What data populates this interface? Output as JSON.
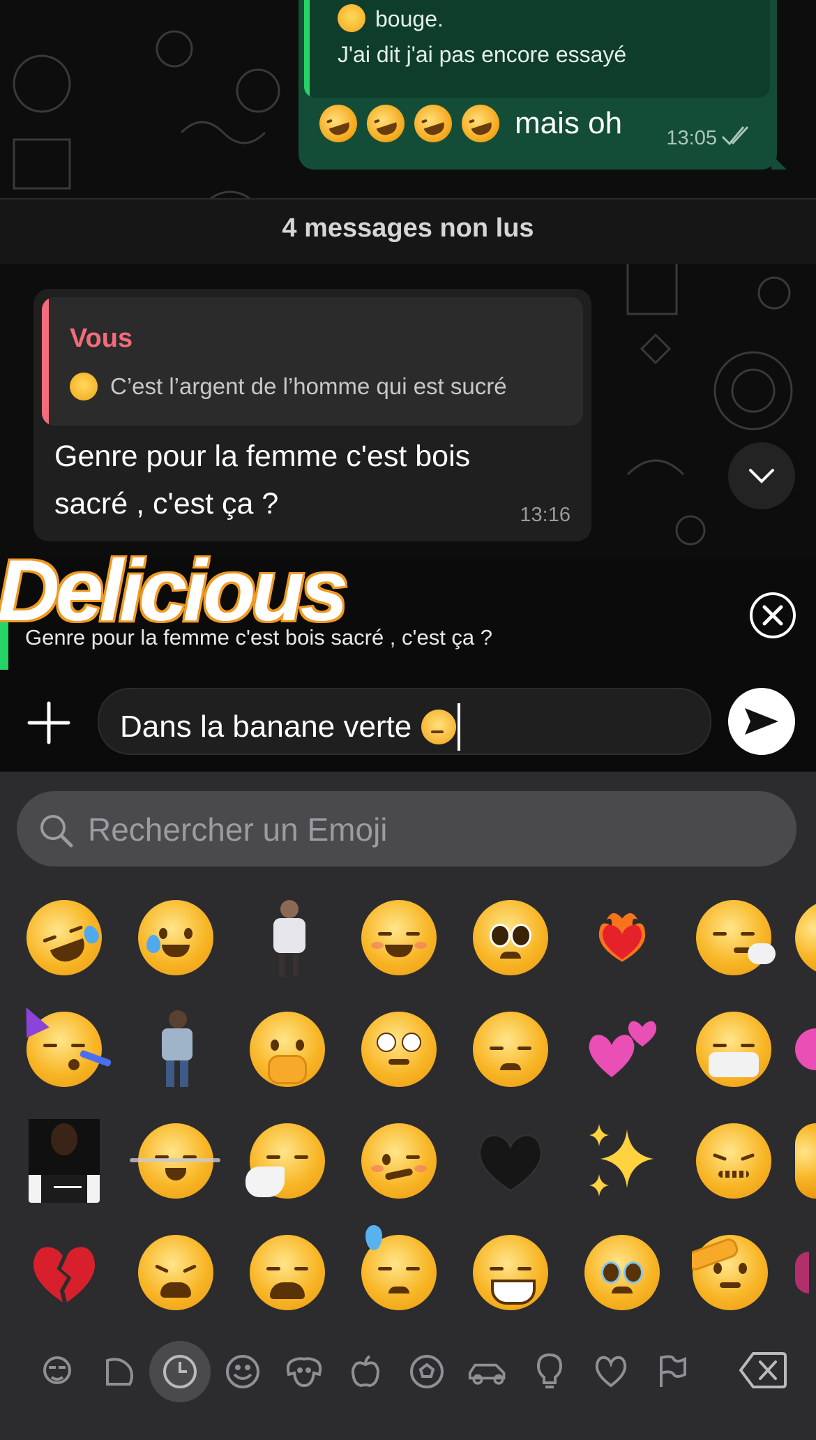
{
  "chat": {
    "outgoing": {
      "quote_line1": "bouge.",
      "quote_line2": "J'ai dit j'ai pas encore essayé",
      "text": "mais oh",
      "time": "13:05",
      "emoji": [
        "rofl-emoji",
        "rofl-emoji",
        "rofl-emoji",
        "rofl-emoji"
      ],
      "quote_emoji": "joy-emoji",
      "status": "read-double-check-icon"
    },
    "unread_divider": "4 messages non lus",
    "incoming": {
      "quote_author": "Vous",
      "quote_text": "C’est l’argent de l’homme qui est sucré",
      "quote_emoji": "relieved-emoji",
      "text": "Genre pour la femme c'est bois sacré , c'est ça ?",
      "time": "13:16"
    }
  },
  "reply_preview": {
    "sticker_text": "Delicious",
    "text": "Genre pour la femme c'est bois sacré , c'est ça ?"
  },
  "composer": {
    "text": "Dans la banane verte",
    "text_emoji": "face-exhaling-emoji"
  },
  "keyboard": {
    "search_placeholder": "Rechercher un Emoji",
    "rows": [
      [
        "rofl",
        "smiling-tear",
        "sticker-person-1",
        "relaxed",
        "pleading",
        "heart-on-fire",
        "face-exhaling",
        "partial"
      ],
      [
        "partying",
        "sticker-person-2",
        "hand-over-mouth",
        "rolling-eyes",
        "pensive",
        "two-hearts",
        "mask",
        "partial"
      ],
      [
        "sticker-photo",
        "relieved-wind",
        "sneezing",
        "woozy",
        "black-heart",
        "sparkles",
        "confounded",
        "partial"
      ],
      [
        "broken-heart",
        "tired",
        "weary",
        "downcast-sweat",
        "laughing",
        "holding-tears",
        "saluting",
        "partial"
      ]
    ],
    "tabs": [
      "memoji-tab",
      "stickers-tab",
      "recent-tab",
      "smileys-tab",
      "animals-tab",
      "food-tab",
      "activity-tab",
      "travel-tab",
      "objects-tab",
      "symbols-tab",
      "flags-tab"
    ],
    "active_tab": "recent-tab"
  },
  "colors": {
    "outgoing_bubble": "#144d37",
    "incoming_bubble": "#1f1f1f",
    "accent_green": "#25d366",
    "quote_pink": "#f36c7b",
    "keyboard_bg": "#2c2c2e"
  }
}
